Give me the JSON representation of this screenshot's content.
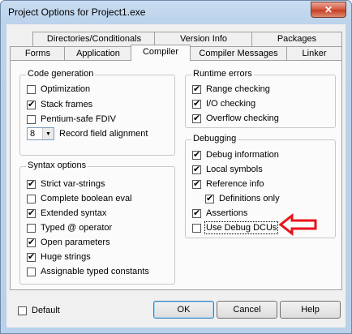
{
  "window": {
    "title": "Project Options for Project1.exe",
    "close_label": "✕"
  },
  "tabs_back": [
    "Directories/Conditionals",
    "Version Info",
    "Packages"
  ],
  "tabs_front": [
    "Forms",
    "Application",
    "Compiler",
    "Compiler Messages",
    "Linker"
  ],
  "active_tab": "Compiler",
  "code_generation": {
    "title": "Code generation",
    "items": [
      {
        "label": "Optimization",
        "checked": false
      },
      {
        "label": "Stack frames",
        "checked": true
      },
      {
        "label": "Pentium-safe FDIV",
        "checked": false
      }
    ],
    "record_alignment": {
      "value": "8",
      "label": "Record field alignment"
    }
  },
  "syntax_options": {
    "title": "Syntax options",
    "items": [
      {
        "label": "Strict var-strings",
        "checked": true
      },
      {
        "label": "Complete boolean eval",
        "checked": false
      },
      {
        "label": "Extended syntax",
        "checked": true
      },
      {
        "label": "Typed @ operator",
        "checked": false
      },
      {
        "label": "Open parameters",
        "checked": true
      },
      {
        "label": "Huge strings",
        "checked": true
      },
      {
        "label": "Assignable typed constants",
        "checked": false
      }
    ]
  },
  "runtime_errors": {
    "title": "Runtime errors",
    "items": [
      {
        "label": "Range checking",
        "checked": true
      },
      {
        "label": "I/O checking",
        "checked": true
      },
      {
        "label": "Overflow checking",
        "checked": true
      }
    ]
  },
  "debugging": {
    "title": "Debugging",
    "items": [
      {
        "label": "Debug information",
        "checked": true
      },
      {
        "label": "Local symbols",
        "checked": true
      },
      {
        "label": "Reference info",
        "checked": true
      },
      {
        "label": "Definitions only",
        "checked": true
      },
      {
        "label": "Assertions",
        "checked": true
      },
      {
        "label": "Use Debug DCUs",
        "checked": false
      }
    ]
  },
  "footer": {
    "default_label": "Default",
    "default_checked": false,
    "ok_label": "OK",
    "cancel_label": "Cancel",
    "help_label": "Help"
  },
  "annotation": {
    "arrow_color": "#e8121a"
  }
}
